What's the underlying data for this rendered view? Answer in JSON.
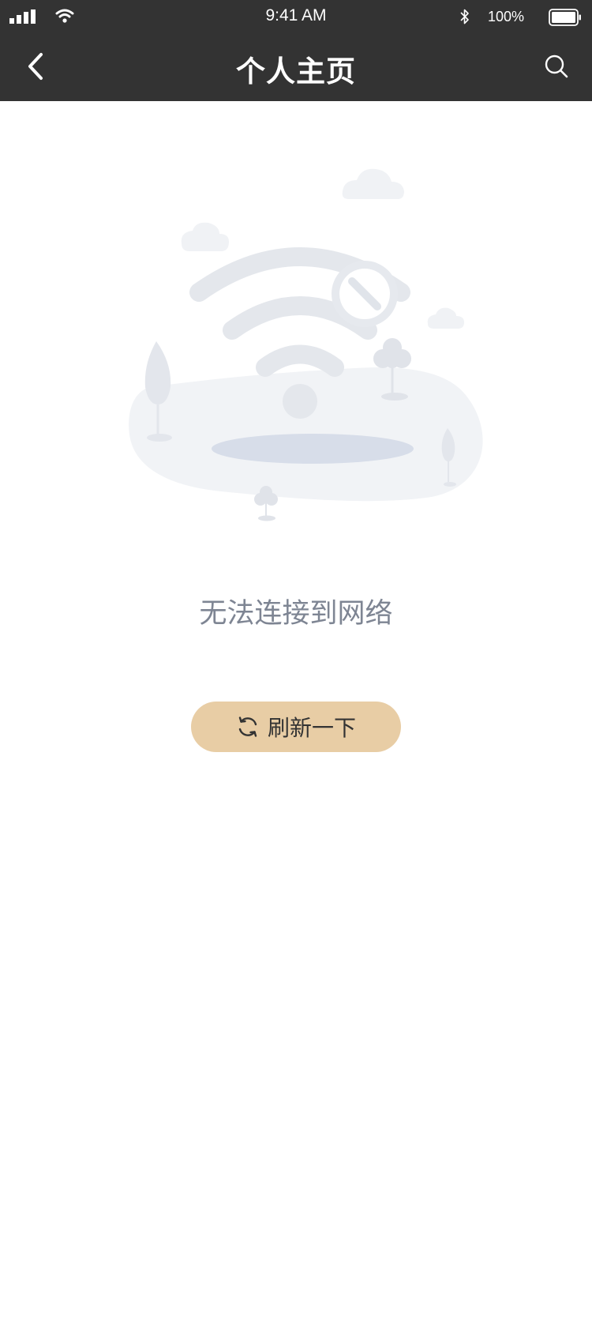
{
  "status_bar": {
    "time": "9:41 AM",
    "battery_percent": "100%",
    "battery_level": 1.0,
    "signal_bars": 4,
    "icons": [
      "signal-icon",
      "wifi-icon",
      "bluetooth-icon",
      "battery-icon"
    ]
  },
  "nav": {
    "title": "个人主页",
    "back_icon": "chevron-left-icon",
    "search_icon": "search-icon"
  },
  "empty_state": {
    "illustration": "no-network-illustration",
    "message": "无法连接到网络",
    "refresh_label": "刷新一下",
    "refresh_icon": "refresh-icon"
  },
  "colors": {
    "header_bg": "#333333",
    "accent": "#e8cda5",
    "message_text": "#7e8593"
  }
}
